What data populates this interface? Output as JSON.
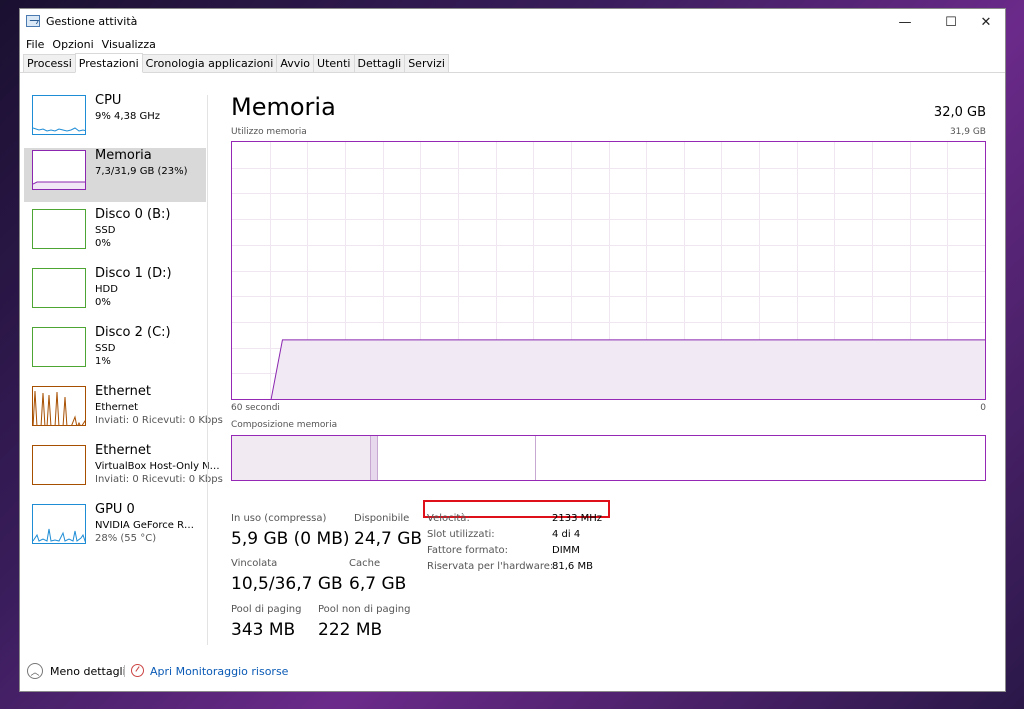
{
  "window": {
    "title": "Gestione attività",
    "controls": {
      "minimize": "—",
      "maximize": "☐",
      "close": "✕"
    }
  },
  "menu": [
    "File",
    "Opzioni",
    "Visualizza"
  ],
  "tabs": [
    "Processi",
    "Prestazioni",
    "Cronologia applicazioni",
    "Avvio",
    "Utenti",
    "Dettagli",
    "Servizi"
  ],
  "active_tab": "Prestazioni",
  "sidebar": {
    "items": [
      {
        "name": "CPU",
        "line1": "9%  4,38 GHz",
        "line2": "",
        "color": "#1f8dd6"
      },
      {
        "name": "Memoria",
        "line1": "7,3/31,9 GB (23%)",
        "line2": "",
        "color": "#8b26b0"
      },
      {
        "name": "Disco 0 (B:)",
        "line1": "SSD",
        "line2": "0%",
        "color": "#4da533"
      },
      {
        "name": "Disco 1 (D:)",
        "line1": "HDD",
        "line2": "0%",
        "color": "#4da533"
      },
      {
        "name": "Disco 2 (C:)",
        "line1": "SSD",
        "line2": "1%",
        "color": "#4da533"
      },
      {
        "name": "Ethernet",
        "line1": "Ethernet",
        "line2": "Inviati: 0 Ricevuti: 0 Kbps",
        "color": "#a74f01"
      },
      {
        "name": "Ethernet",
        "line1": "VirtualBox Host-Only N…",
        "line2": "Inviati: 0 Ricevuti: 0 Kbps",
        "color": "#a74f01"
      },
      {
        "name": "GPU 0",
        "line1": "NVIDIA GeForce R…",
        "line2": "28%  (55 °C)",
        "color": "#1f8dd6"
      }
    ]
  },
  "main": {
    "title": "Memoria",
    "total": "32,0 GB",
    "usage_label": "Utilizzo memoria",
    "usage_max": "31,9 GB",
    "time_left": "60 secondi",
    "time_right": "0",
    "composition_label": "Composizione memoria",
    "accent_color": "#8b26b0",
    "usage_fraction": 0.23,
    "composition": {
      "in_use_gb": 5.9,
      "modified_gb": 0.3,
      "standby_gb": 6.7,
      "free_gb": 19.0
    },
    "stats": {
      "in_use_label": "In uso (compressa)",
      "in_use_value": "5,9 GB (0 MB)",
      "available_label": "Disponibile",
      "available_value": "24,7 GB",
      "committed_label": "Vincolata",
      "committed_value": "10,5/36,7 GB",
      "cache_label": "Cache",
      "cache_value": "6,7 GB",
      "paged_label": "Pool di paging",
      "paged_value": "343 MB",
      "nonpaged_label": "Pool non di paging",
      "nonpaged_value": "222 MB"
    },
    "hardware": {
      "speed_label": "Velocità:",
      "speed_value": "2133 MHz",
      "slots_label": "Slot utilizzati:",
      "slots_value": "4 di 4",
      "form_label": "Fattore formato:",
      "form_value": "DIMM",
      "reserved_label": "Riservata per l'hardware:",
      "reserved_value": "81,6 MB"
    }
  },
  "footer": {
    "less_details": "Meno dettagli",
    "open_monitor": "Apri Monitoraggio risorse"
  }
}
